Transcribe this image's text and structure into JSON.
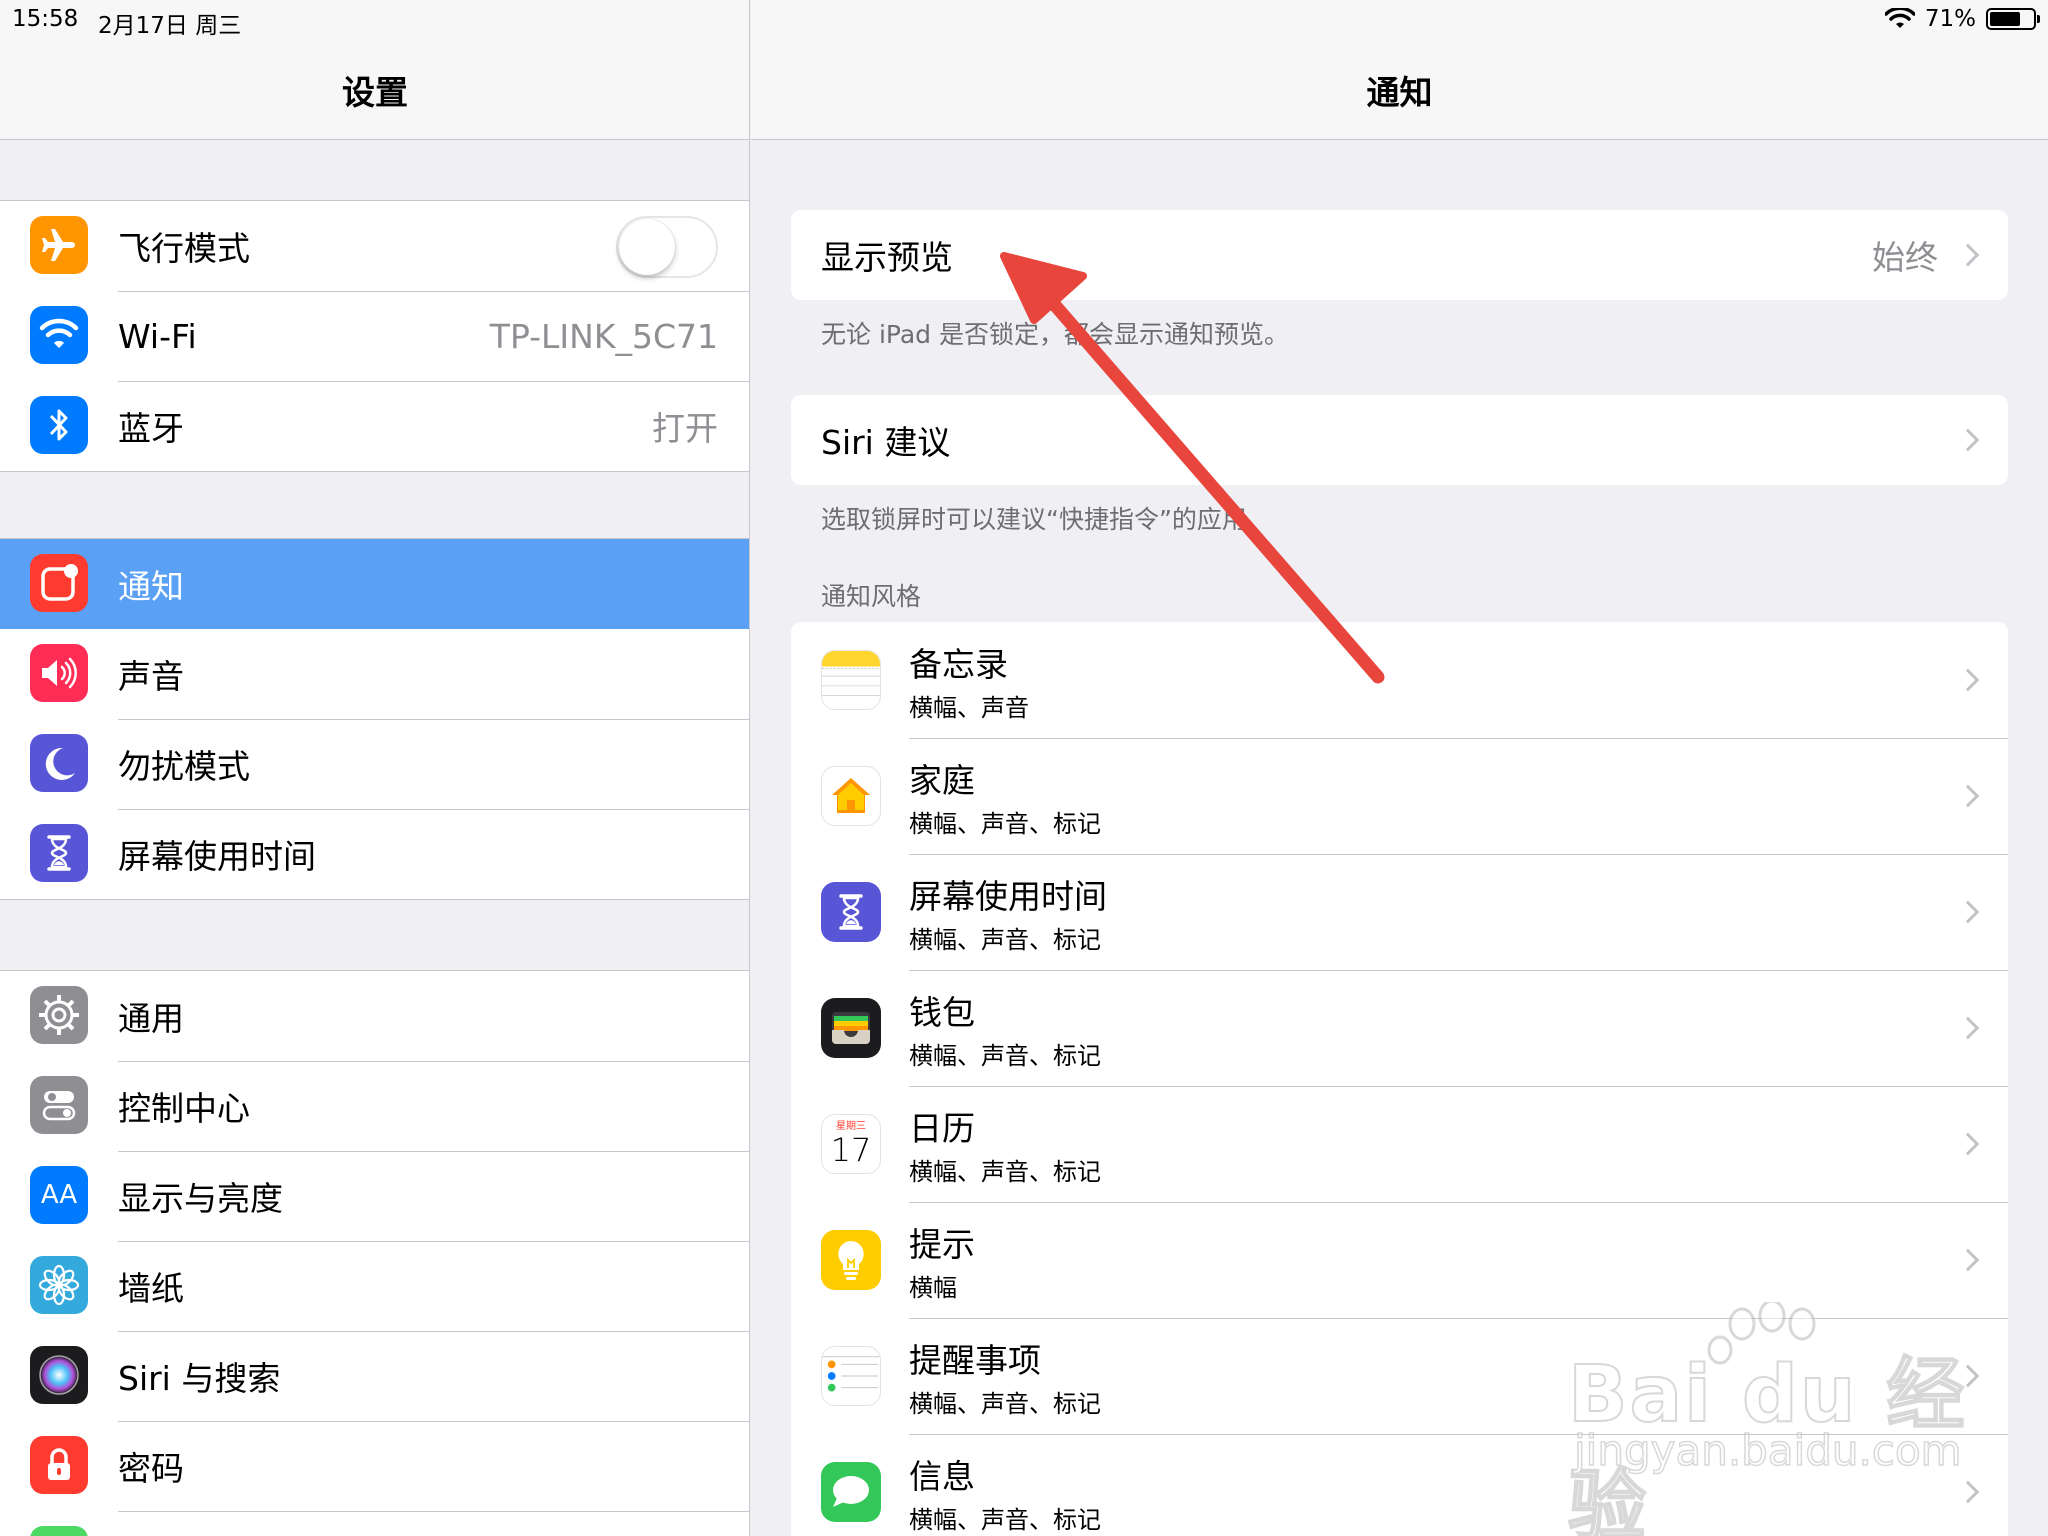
{
  "status_bar": {
    "time": "15:58",
    "date": "2月17日 周三",
    "battery": "71%",
    "battery_level": 0.71
  },
  "left": {
    "title": "设置",
    "groups": [
      [
        {
          "label": "飞行模式",
          "icon": "airplane-icon",
          "color": "#ff9500",
          "toggle": false
        },
        {
          "label": "Wi-Fi",
          "icon": "wifi-icon",
          "color": "#007aff",
          "value": "TP-LINK_5C71"
        },
        {
          "label": "蓝牙",
          "icon": "bluetooth-icon",
          "color": "#007aff",
          "value": "打开"
        }
      ],
      [
        {
          "label": "通知",
          "icon": "notifications-icon",
          "color": "#ff3b30",
          "selected": true
        },
        {
          "label": "声音",
          "icon": "sound-icon",
          "color": "#ff2d55"
        },
        {
          "label": "勿扰模式",
          "icon": "moon-icon",
          "color": "#5856d6"
        },
        {
          "label": "屏幕使用时间",
          "icon": "hourglass-icon",
          "color": "#5856d6"
        }
      ],
      [
        {
          "label": "通用",
          "icon": "gear-icon",
          "color": "#8e8e93"
        },
        {
          "label": "控制中心",
          "icon": "switches-icon",
          "color": "#8e8e93"
        },
        {
          "label": "显示与亮度",
          "icon": "display-icon",
          "color": "#007aff",
          "glyph": "AA"
        },
        {
          "label": "墙纸",
          "icon": "flower-icon",
          "color": "#34aadc"
        },
        {
          "label": "Siri 与搜索",
          "icon": "siri-icon",
          "color": "#000000"
        },
        {
          "label": "密码",
          "icon": "lock-icon",
          "color": "#ff3b30"
        }
      ]
    ]
  },
  "right": {
    "title": "通知",
    "show_preview": {
      "label": "显示预览",
      "value": "始终"
    },
    "show_preview_note": "无论 iPad 是否锁定，都会显示通知预览。",
    "siri": {
      "label": "Siri 建议"
    },
    "siri_note": "选取锁屏时可以建议“快捷指令”的应用",
    "section_header": "通知风格",
    "apps": [
      {
        "name": "备忘录",
        "sub": "横幅、声音",
        "icon": "notes-icon"
      },
      {
        "name": "家庭",
        "sub": "横幅、声音、标记",
        "icon": "home-icon"
      },
      {
        "name": "屏幕使用时间",
        "sub": "横幅、声音、标记",
        "icon": "screen-time-icon"
      },
      {
        "name": "钱包",
        "sub": "横幅、声音、标记",
        "icon": "wallet-icon"
      },
      {
        "name": "日历",
        "sub": "横幅、声音、标记",
        "icon": "calendar-icon",
        "day": "17",
        "weekday": "星期三"
      },
      {
        "name": "提示",
        "sub": "横幅",
        "icon": "tips-icon"
      },
      {
        "name": "提醒事项",
        "sub": "横幅、声音、标记",
        "icon": "reminders-icon"
      },
      {
        "name": "信息",
        "sub": "横幅、声音、标记",
        "icon": "messages-icon"
      }
    ]
  },
  "watermark": {
    "brand": "Bai du 经验",
    "url": "jingyan.baidu.com"
  },
  "colors": {
    "selected_row": "#5aa0f5",
    "annotation_arrow": "#e8453c"
  }
}
